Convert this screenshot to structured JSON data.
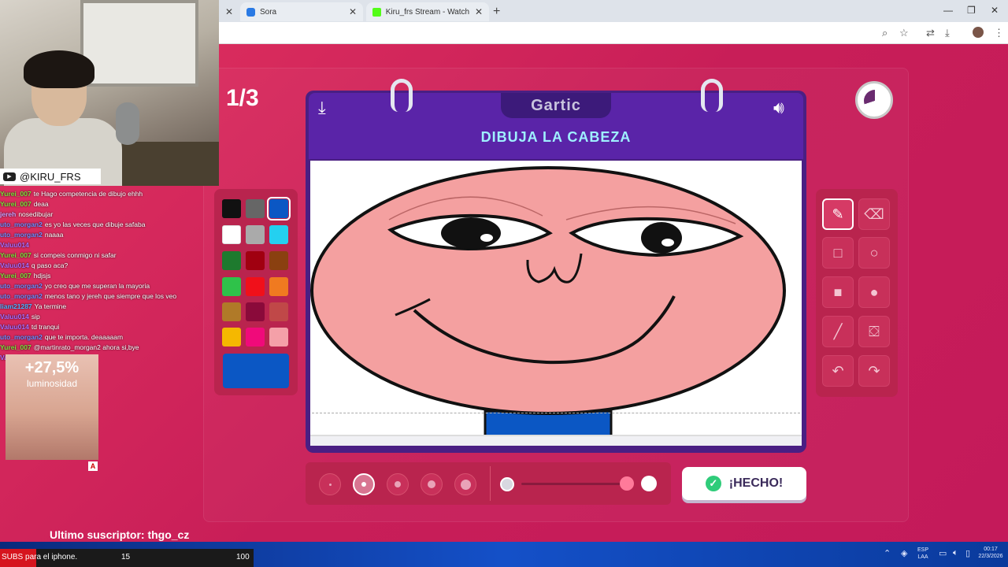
{
  "browser": {
    "tabs": [
      {
        "label": "Sora",
        "icon": "sora-favicon-icon"
      },
      {
        "label": "Kiru_frs Stream - Watch Live on",
        "icon": "kick-favicon-icon"
      }
    ],
    "new_tab": "+",
    "window_controls": [
      "—",
      "❐",
      "✕"
    ],
    "addr_icons": [
      "⌕",
      "☆",
      "⇄",
      "⤓"
    ]
  },
  "game": {
    "round": "1/3",
    "logo": "Gartic",
    "instruction": "DIBUJA LA CABEZA",
    "done_label": "¡HECHO!",
    "timer_remaining_fraction": 0.7,
    "palette": [
      "#111111",
      "#666666",
      "#0b57c4",
      "#ffffff",
      "#aaaaaa",
      "#24d0f0",
      "#1e7a2e",
      "#a00010",
      "#8a4010",
      "#2fc24a",
      "#f0101a",
      "#f07a20",
      "#b07a28",
      "#8a0a3a",
      "#c04848",
      "#f5b800",
      "#f00a7a",
      "#f4a0a8"
    ],
    "selected_color": "#0b57c4",
    "brush_sizes": [
      "xs",
      "s",
      "m",
      "l",
      "xl"
    ],
    "selected_size_index": 1,
    "opacity_level": 1.0,
    "tools": [
      "pencil-icon",
      "eraser-icon",
      "square-outline-icon",
      "circle-outline-icon",
      "square-filled-icon",
      "circle-filled-icon",
      "line-icon",
      "fill-bucket-icon",
      "undo-icon",
      "redo-icon"
    ],
    "selected_tool": "pencil-icon"
  },
  "stream": {
    "handle": "@KIRU_FRS",
    "last_sub": "Ultimo suscriptor: thgo_cz",
    "ad": {
      "pct": "+27,5%",
      "label": "luminosidad",
      "mark": "A"
    },
    "chat": [
      {
        "user": "Yurei_007",
        "text": "te Hago competencia de dibujo ehhh",
        "color": "#7ce03a"
      },
      {
        "user": "Yurei_007",
        "text": "deaa",
        "color": "#7ce03a"
      },
      {
        "user": "jereh",
        "text": "nosedibujar",
        "color": "#c9a0ff"
      },
      {
        "user": "uto_morgan2",
        "text": "es yo las veces que dibuje safaba",
        "color": "#6e8cff"
      },
      {
        "user": "uto_morgan2",
        "text": "naaaa",
        "color": "#6e8cff"
      },
      {
        "user": "Valuu014",
        "text": "",
        "color": "#a86cff"
      },
      {
        "user": "Yurei_007",
        "text": "si compeis conmigo ni safar",
        "color": "#7ce03a"
      },
      {
        "user": "Valuu014",
        "text": "q paso aca?",
        "color": "#a86cff"
      },
      {
        "user": "Yurei_007",
        "text": "hdjsjs",
        "color": "#7ce03a"
      },
      {
        "user": "uto_morgan2",
        "text": "yo creo que me superan la mayoria",
        "color": "#6e8cff"
      },
      {
        "user": "uto_morgan2",
        "text": "menos tano y jereh que siempre que los veo",
        "color": "#6e8cff"
      },
      {
        "user": "liam21287",
        "text": "Ya termine",
        "color": "#4fb0ff"
      },
      {
        "user": "Valuu014",
        "text": "sip",
        "color": "#a86cff"
      },
      {
        "user": "Valuu014",
        "text": "td tranqui",
        "color": "#a86cff"
      },
      {
        "user": "uto_morgan2",
        "text": "que te importa. deaaaaam",
        "color": "#6e8cff"
      },
      {
        "user": "Yurei_007",
        "text": "@martinrato_morgan2 ahora si,bye",
        "color": "#7ce03a"
      },
      {
        "user": "Valuu014",
        "text": "",
        "color": "#a86cff"
      }
    ]
  },
  "subs": {
    "label": "SUBS para el iphone.",
    "current": "15",
    "goal": "100"
  },
  "taskbar": {
    "lang": "ESP\nLAA",
    "time": "00:17",
    "date": "22/3/2026"
  }
}
